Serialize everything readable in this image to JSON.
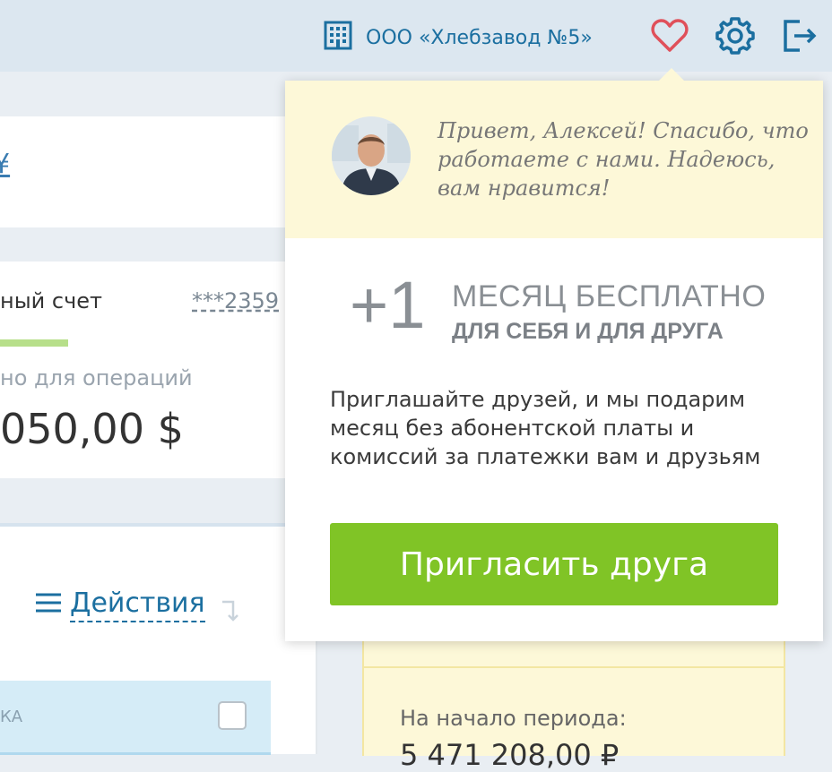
{
  "header": {
    "company_name": "ООО «Хлебзавод №5»",
    "icons": [
      "building-icon",
      "heart-icon",
      "gear-icon",
      "logout-icon"
    ],
    "heart_color": "#e0505a",
    "icon_color": "#1b6fa0"
  },
  "account": {
    "top_card_symbol": "¥",
    "name": "ный счет",
    "number": "***2359",
    "available_label": "но для операций",
    "balance": "050,00 $"
  },
  "actions": {
    "label": "Действия"
  },
  "table": {
    "column": "КА"
  },
  "period": {
    "start_label": "На начало периода:",
    "start_value": "5 471 208,00 ₽"
  },
  "popup": {
    "greeting": "Привет, Алексей! Спасибо, что работаете с нами. Надеюсь, вам нравится!",
    "plus": "+1",
    "offer_title": "МЕСЯЦ БЕСПЛАТНО",
    "offer_subtitle": "ДЛЯ СЕБЯ И ДЛЯ ДРУГА",
    "description": "Приглашайте друзей, и мы подарим месяц без абонентской платы и комиссий за платежки вам и друзьям",
    "button_label": "Пригласить друга",
    "button_color": "#80c426",
    "bg_color": "#fdf8d8"
  }
}
